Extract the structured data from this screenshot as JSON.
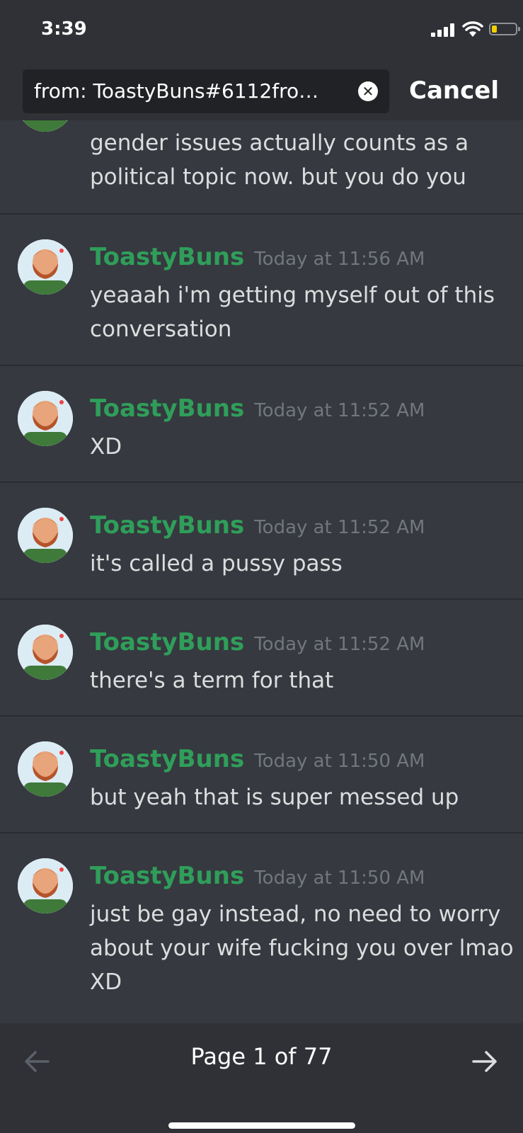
{
  "status_bar": {
    "time": "3:39"
  },
  "search": {
    "query": "from: ToastyBuns#6112fro…",
    "cancel_label": "Cancel"
  },
  "partial_message": {
    "text": "gender issues actually counts as a political topic now. but you do you"
  },
  "messages": [
    {
      "author": "ToastyBuns",
      "timestamp": "Today at 11:56 AM",
      "text": "yeaaah i'm getting myself out of this conversation"
    },
    {
      "author": "ToastyBuns",
      "timestamp": "Today at 11:52 AM",
      "text": "XD"
    },
    {
      "author": "ToastyBuns",
      "timestamp": "Today at 11:52 AM",
      "text": "it's called a pussy pass"
    },
    {
      "author": "ToastyBuns",
      "timestamp": "Today at 11:52 AM",
      "text": "there's a term for that"
    },
    {
      "author": "ToastyBuns",
      "timestamp": "Today at 11:50 AM",
      "text": "but yeah that is super messed up"
    },
    {
      "author": "ToastyBuns",
      "timestamp": "Today at 11:50 AM",
      "text": "just be gay instead, no need to worry about your wife fucking you over lmao XD"
    }
  ],
  "pagination": {
    "label": "Page 1 of 77"
  },
  "colors": {
    "background": "#36393f",
    "header": "#2f3136",
    "author": "#2f9e5a",
    "timestamp": "#72767d"
  }
}
